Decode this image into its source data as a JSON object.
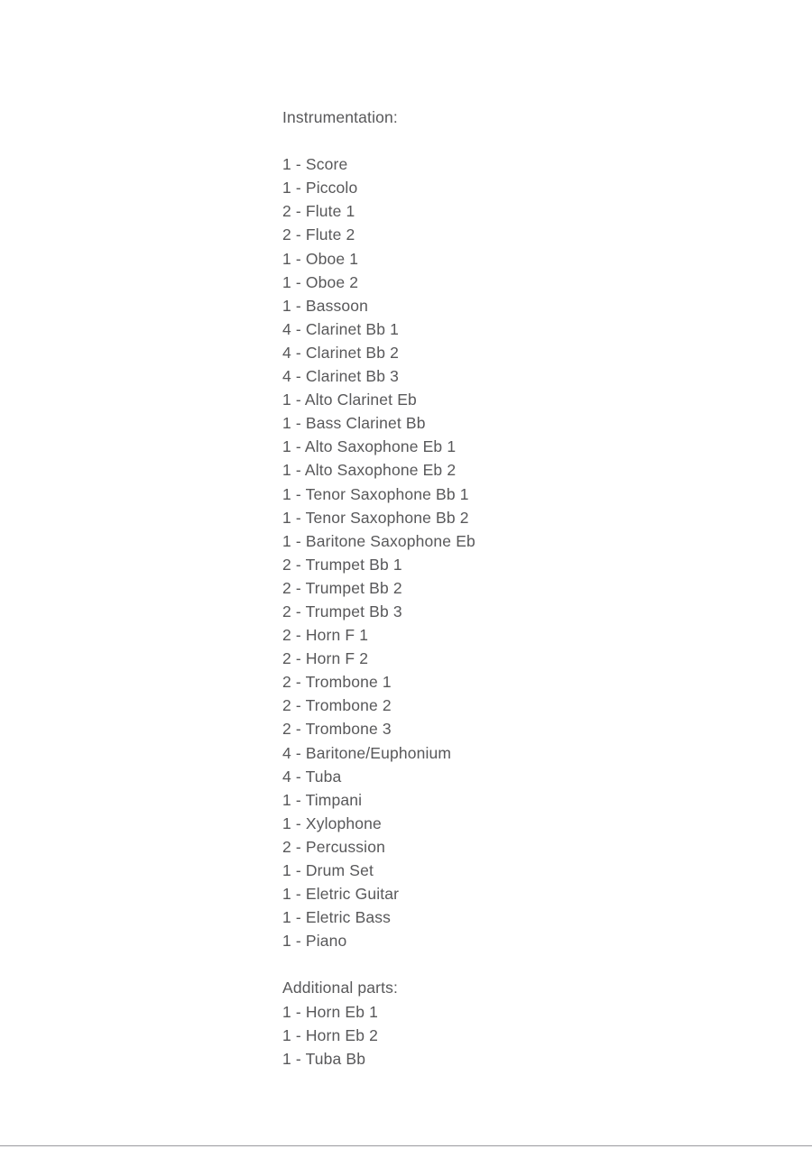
{
  "document": {
    "background_color": "#ffffff",
    "text_color": "#58585a",
    "rule_color": "#9a9a9e",
    "instrumentation": {
      "heading": "Instrumentation:",
      "parts": [
        "1 - Score",
        "1 - Piccolo",
        "2 - Flute 1",
        "2 - Flute 2",
        "1 - Oboe 1",
        "1 - Oboe 2",
        "1 - Bassoon",
        "4 - Clarinet Bb 1",
        "4 - Clarinet Bb 2",
        "4 - Clarinet Bb 3",
        "1 - Alto Clarinet Eb",
        "1 - Bass Clarinet Bb",
        "1 - Alto Saxophone Eb 1",
        "1 - Alto Saxophone Eb 2",
        "1 - Tenor Saxophone Bb 1",
        "1 - Tenor Saxophone Bb 2",
        "1 - Baritone Saxophone Eb",
        "2 - Trumpet Bb 1",
        "2 - Trumpet Bb 2",
        "2 - Trumpet Bb 3",
        "2 - Horn F 1",
        "2 - Horn F 2",
        "2 - Trombone 1",
        "2 - Trombone 2",
        "2 - Trombone 3",
        "4 - Baritone/Euphonium",
        "4 - Tuba",
        "1 - Timpani",
        "1 - Xylophone",
        "2 - Percussion",
        "1 - Drum Set",
        "1 - Eletric Guitar",
        "1 - Eletric Bass",
        "1 - Piano"
      ]
    },
    "additional": {
      "heading": "Additional parts:",
      "parts": [
        "1 - Horn Eb 1",
        "1 - Horn Eb 2",
        "1 - Tuba Bb"
      ]
    }
  }
}
